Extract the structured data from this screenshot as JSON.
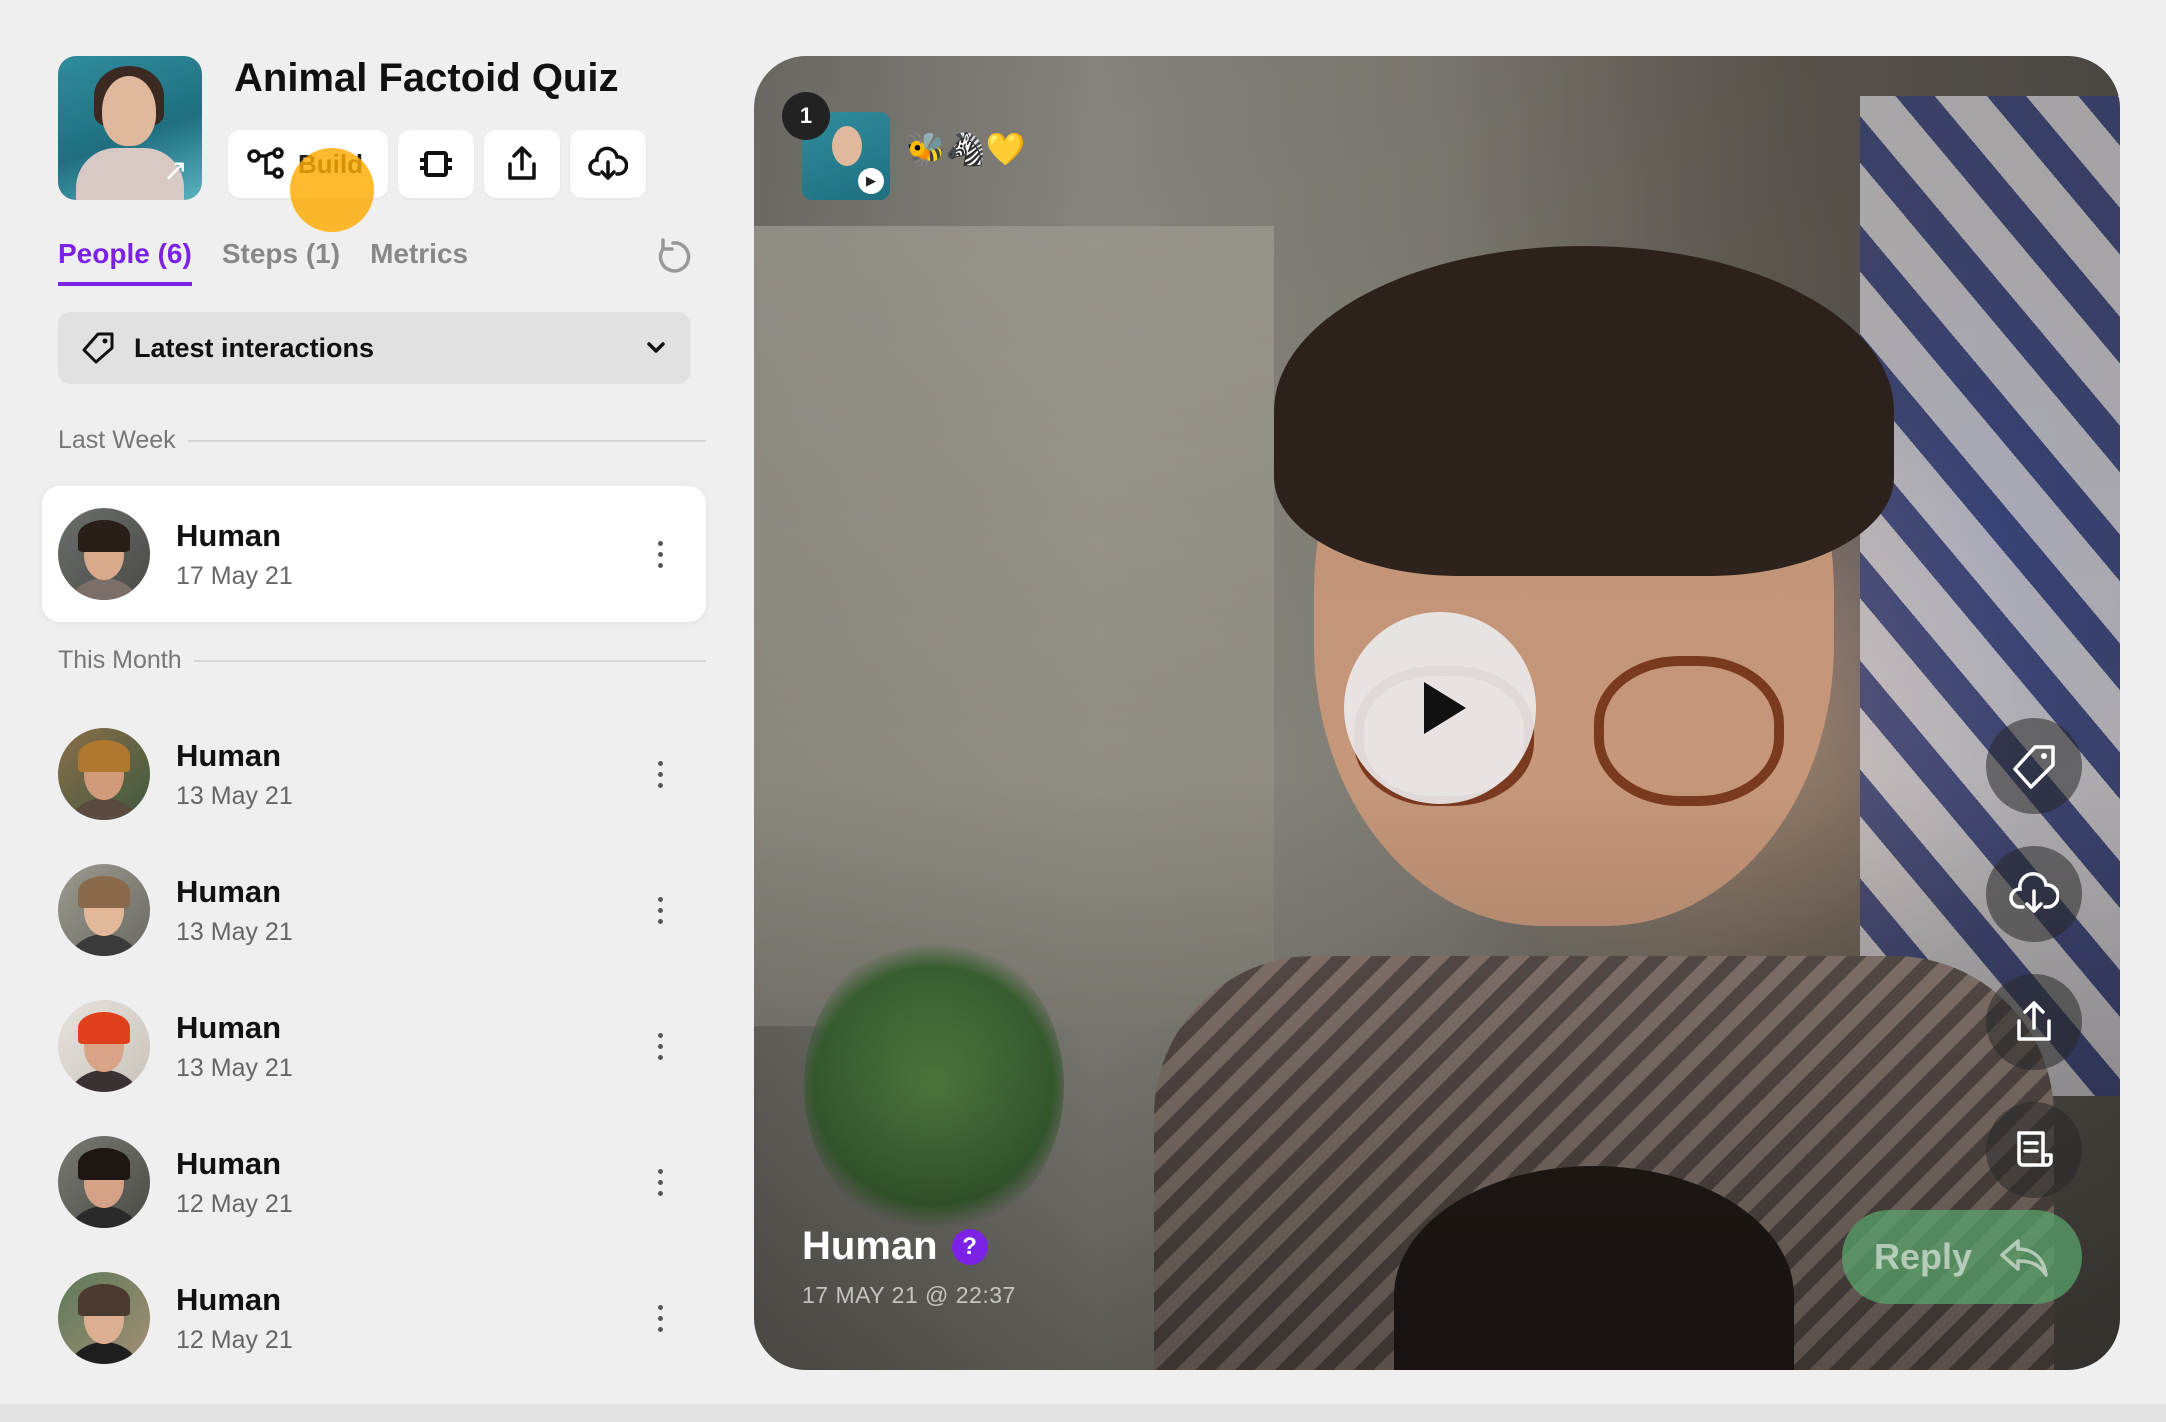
{
  "quiz": {
    "title": "Animal Factoid Quiz",
    "thumbnail_icon": "external-arrow-icon"
  },
  "toolbar": {
    "build_label": "Build",
    "buttons": [
      "build",
      "embed",
      "share",
      "download"
    ]
  },
  "tabs": [
    {
      "label": "People (6)",
      "active": true
    },
    {
      "label": "Steps (1)",
      "active": false
    },
    {
      "label": "Metrics",
      "active": false
    }
  ],
  "filter": {
    "label": "Latest interactions"
  },
  "sections": {
    "last_week": "Last Week",
    "this_month": "This Month"
  },
  "people": [
    {
      "name": "Human",
      "date": "17 May 21",
      "selected": true
    },
    {
      "name": "Human",
      "date": "13 May 21",
      "selected": false
    },
    {
      "name": "Human",
      "date": "13 May 21",
      "selected": false
    },
    {
      "name": "Human",
      "date": "13 May 21",
      "selected": false
    },
    {
      "name": "Human",
      "date": "12 May 21",
      "selected": false
    },
    {
      "name": "Human",
      "date": "12 May 21",
      "selected": false
    }
  ],
  "video": {
    "step_number": "1",
    "emoji": "🐝🦓💛",
    "person_name": "Human",
    "question_mark": "?",
    "timestamp": "17 MAY 21 @ 22:37",
    "reply_label": "Reply"
  },
  "colors": {
    "accent": "#7b22e6",
    "reply": "#5aaa6e",
    "cursor": "#ffaa00"
  }
}
